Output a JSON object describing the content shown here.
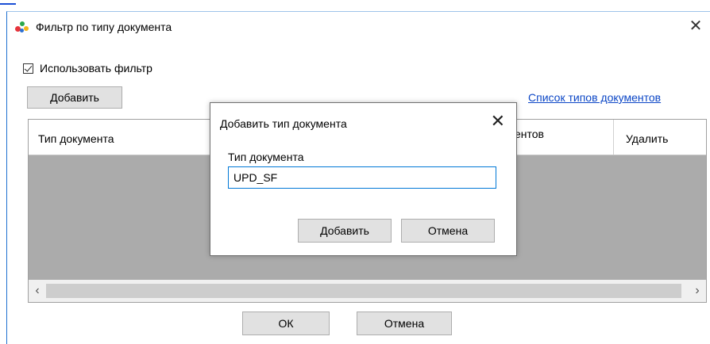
{
  "dialog": {
    "title": "Фильтр по типу документа",
    "use_filter_label": "Использовать фильтр",
    "use_filter_checked": true,
    "add_button": "Добавить",
    "types_list_link": "Список типов документов",
    "grid": {
      "columns": [
        "Тип документа",
        "ентов",
        "Удалить"
      ]
    },
    "ok_button": "ОК",
    "cancel_button": "Отмена"
  },
  "modal": {
    "title": "Добавить тип документа",
    "field_label": "Тип документа",
    "field_value": "UPD_SF",
    "add_button": "Добавить",
    "cancel_button": "Отмена"
  },
  "icons": {
    "close": "close-icon",
    "app": "app-icon",
    "checkbox": "checkmark-icon",
    "scroll_left": "chevron-left-icon",
    "scroll_right": "chevron-right-icon"
  }
}
